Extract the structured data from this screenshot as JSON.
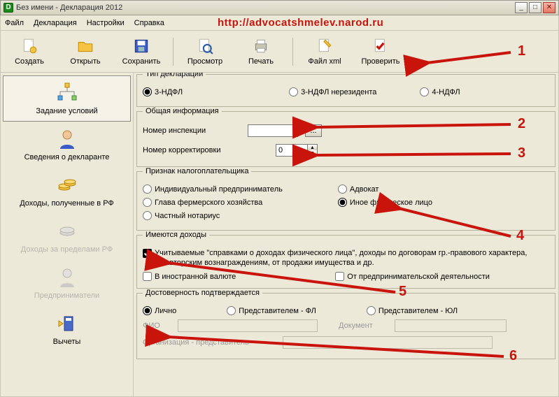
{
  "window": {
    "title": "Без имени - Декларация 2012",
    "icon_letter": "D"
  },
  "overlay_url": "http://advocatshmelev.narod.ru",
  "menu": {
    "file": "Файл",
    "decl": "Декларация",
    "settings": "Настройки",
    "help": "Справка"
  },
  "toolbar": {
    "create": "Создать",
    "open": "Открыть",
    "save": "Сохранить",
    "view": "Просмотр",
    "print": "Печать",
    "xml": "Файл xml",
    "check": "Проверить"
  },
  "sidebar": {
    "cond": "Задание условий",
    "declarant": "Сведения о декларанте",
    "inc_rf": "Доходы, полученные в РФ",
    "inc_abroad": "Доходы за пределами РФ",
    "entr": "Предприниматели",
    "deduct": "Вычеты"
  },
  "group_type": {
    "legend": "Тип декларации",
    "o1": "3-НДФЛ",
    "o2": "3-НДФЛ нерезидента",
    "o3": "4-НДФЛ"
  },
  "group_gen": {
    "legend": "Общая информация",
    "inspection_label": "Номер инспекции",
    "inspection_value": "",
    "correction_label": "Номер корректировки",
    "correction_value": "0"
  },
  "group_tax": {
    "legend": "Признак налогоплательщика",
    "o1": "Индивидуальный предприниматель",
    "o2": "Адвокат",
    "o3": "Глава фермерского хозяйства",
    "o4": "Иное физическое лицо",
    "o5": "Частный нотариус"
  },
  "group_income": {
    "legend": "Имеются доходы",
    "o1": "Учитываемые \"справками о доходах физического лица\", доходы по договорам гр.-правового характера, по авторским вознаграждениям, от продажи имущества и др.",
    "o2": "В иностранной валюте",
    "o3": "От предпринимательской деятельности"
  },
  "group_conf": {
    "legend": "Достоверность подтверждается",
    "o1": "Лично",
    "o2": "Представителем - ФЛ",
    "o3": "Представителем - ЮЛ",
    "fio_label": "ФИО",
    "doc_label": "Документ",
    "org_label": "Организация - представитель"
  },
  "annotations": {
    "n1": "1",
    "n2": "2",
    "n3": "3",
    "n4": "4",
    "n5": "5",
    "n6": "6"
  }
}
